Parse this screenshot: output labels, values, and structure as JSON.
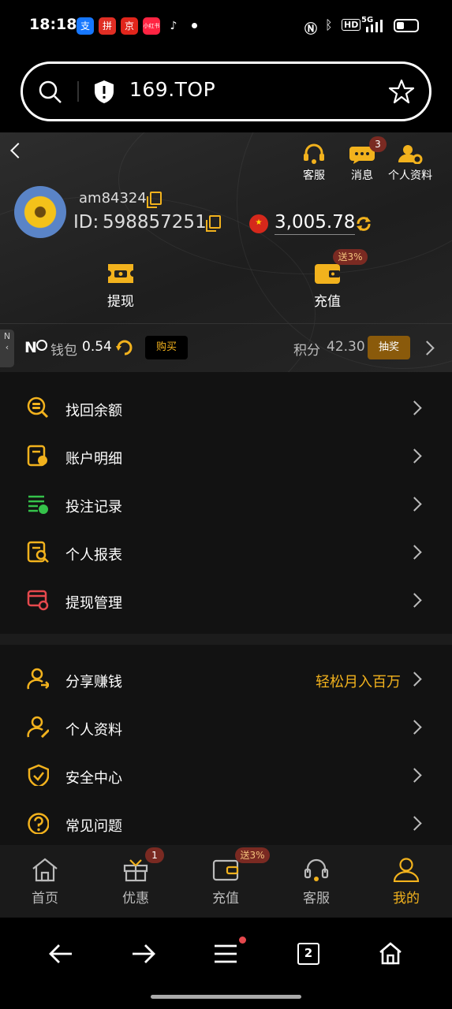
{
  "status_bar": {
    "time": "18:18",
    "apps": [
      "支",
      "拼",
      "京",
      "小红书",
      "♪"
    ],
    "indicators": "HD",
    "network": "5G"
  },
  "browser": {
    "url": "169.TOP"
  },
  "header": {
    "top_actions": [
      {
        "label": "客服",
        "icon": "headset-icon"
      },
      {
        "label": "消息",
        "icon": "message-icon",
        "badge": "3"
      },
      {
        "label": "个人资料",
        "icon": "user-settings-icon"
      }
    ],
    "username": "am84324",
    "id_label": "ID:",
    "id_value": "598857251",
    "balance": "3,005.78",
    "actions": [
      {
        "label": "提现",
        "icon": "withdraw-ticket-icon"
      },
      {
        "label": "充值",
        "icon": "wallet-icon",
        "badge": "送3%"
      }
    ]
  },
  "wallet_bar": {
    "side_tab": "N",
    "brand": "N",
    "wallet_label": "钱包",
    "wallet_value": "0.54",
    "buy_label": "购买",
    "points_label": "积分",
    "points_value": "42.30",
    "draw_label": "抽奖"
  },
  "menu_group_1": [
    {
      "label": "找回余额",
      "icon": "coin-search-icon",
      "color": "#f2b21d"
    },
    {
      "label": "账户明细",
      "icon": "account-detail-icon",
      "color": "#f2b21d"
    },
    {
      "label": "投注记录",
      "icon": "bet-record-icon",
      "color": "#35c24a"
    },
    {
      "label": "个人报表",
      "icon": "report-search-icon",
      "color": "#f2b21d"
    },
    {
      "label": "提现管理",
      "icon": "withdraw-manage-icon",
      "color": "#e5484d"
    }
  ],
  "menu_group_2": [
    {
      "label": "分享赚钱",
      "icon": "share-earn-icon",
      "extra": "轻松月入百万"
    },
    {
      "label": "个人资料",
      "icon": "profile-edit-icon",
      "extra": ""
    },
    {
      "label": "安全中心",
      "icon": "shield-check-icon",
      "extra": ""
    },
    {
      "label": "常见问题",
      "icon": "question-icon",
      "extra": ""
    }
  ],
  "bottom_nav": [
    {
      "label": "首页",
      "icon": "home-icon",
      "active": false
    },
    {
      "label": "优惠",
      "icon": "gift-icon",
      "active": false,
      "badge": "1"
    },
    {
      "label": "充值",
      "icon": "wallet-icon",
      "active": false,
      "badge": "送3%"
    },
    {
      "label": "客服",
      "icon": "headset-icon",
      "active": false
    },
    {
      "label": "我的",
      "icon": "user-icon",
      "active": true
    }
  ],
  "system_nav": {
    "tabs_count": "2"
  },
  "colors": {
    "accent": "#f2b21d",
    "background": "#121212",
    "badge": "#7a2a22"
  }
}
